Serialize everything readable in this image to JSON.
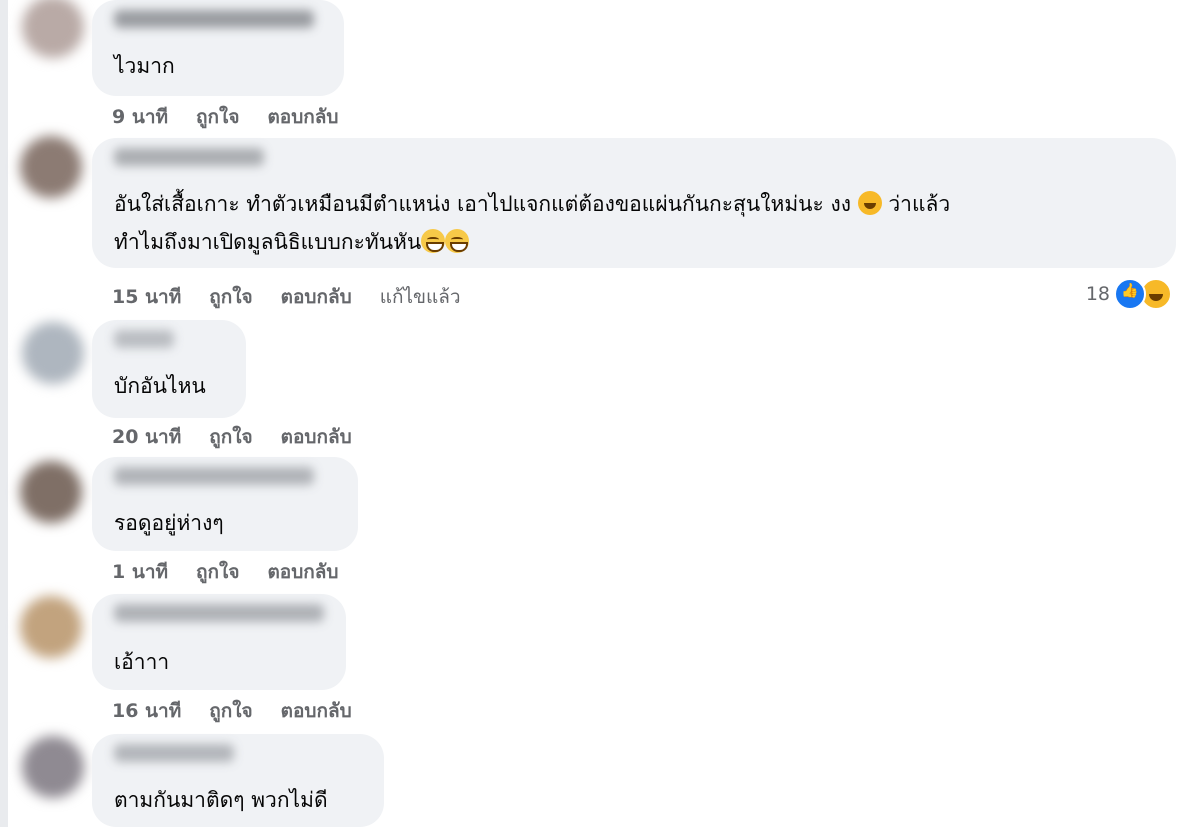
{
  "comments": [
    {
      "lines": [
        "ไวมาก"
      ],
      "time": "9 นาที",
      "like": "ถูกใจ",
      "reply": "ตอบกลับ",
      "edited": ""
    },
    {
      "lines": [
        "อันใส่เสื้อเกาะ ทำตัวเหมือนมีตำแหน่ง เอาไปแจกแต่ต้องขอแผ่นกันกะสุนใหม่นะ งง",
        "ว่าแล้ว",
        "ทำไมถึงมาเปิดมูลนิธิแบบกะทันหัน"
      ],
      "time": "15 นาที",
      "like": "ถูกใจ",
      "reply": "ตอบกลับ",
      "edited": "แก้ไขแล้ว",
      "reaction_count": "18",
      "emojis": [
        "rolling-on-floor-laughing-icon",
        "grinning-sweat-icon",
        "grinning-sweat-icon"
      ]
    },
    {
      "lines": [
        "บักอันไหน"
      ],
      "time": "20 นาที",
      "like": "ถูกใจ",
      "reply": "ตอบกลับ",
      "edited": ""
    },
    {
      "lines": [
        "รอดูอยู่ห่างๆ"
      ],
      "time": "1 นาที",
      "like": "ถูกใจ",
      "reply": "ตอบกลับ",
      "edited": ""
    },
    {
      "lines": [
        "เอ้าาา"
      ],
      "time": "16 นาที",
      "like": "ถูกใจ",
      "reply": "ตอบกลับ",
      "edited": ""
    },
    {
      "lines": [
        "ตามกันมาติดๆ พวกไม่ดี"
      ],
      "time": "",
      "like": "",
      "reply": "",
      "edited": ""
    }
  ],
  "colors": {
    "bubble": "#f0f2f5",
    "meta_text": "#65676b",
    "like_blue": "#1877f2",
    "haha_yellow": "#f7b928"
  }
}
